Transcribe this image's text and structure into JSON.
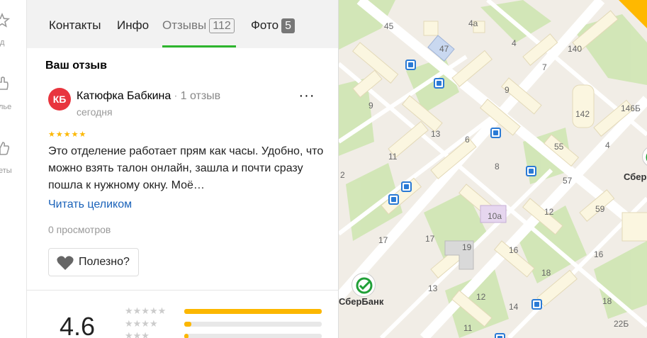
{
  "rail": {
    "items": [
      {
        "label": "д"
      },
      {
        "label": "лье"
      },
      {
        "label": "еты"
      }
    ]
  },
  "tabs": [
    {
      "label": "Контакты"
    },
    {
      "label": "Инфо"
    },
    {
      "label": "Отзывы",
      "count": "112"
    },
    {
      "label": "Фото",
      "count": "5"
    }
  ],
  "section_title": "Ваш отзыв",
  "review": {
    "avatar_initials": "КБ",
    "avatar_color": "#e8353e",
    "author": "Катюфка Бабкина",
    "author_reviews": "1 отзыв",
    "date": "сегодня",
    "more": "···",
    "stars": "★★★★★",
    "rating_stars": 5,
    "text": "Это отделение работает прям как часы. Удобно, что можно взять талон онлайн, зашла и почти сразу пошла к нужному окну. Моё…",
    "read_more": "Читать целиком",
    "views": "0 просмотров",
    "helpful": "Полезно?"
  },
  "summary": {
    "rating": "4.6",
    "distribution": [
      {
        "stars": "★★★★★",
        "share": 1.0
      },
      {
        "stars": "★★★★",
        "share": 0.05
      },
      {
        "stars": "★★★",
        "share": 0.03
      }
    ]
  },
  "map": {
    "poi_label": "СберБанк",
    "poi_label_right": "Сбер",
    "house_numbers": [
      "45",
      "4а",
      "47",
      "4",
      "140",
      "7",
      "9",
      "9",
      "142",
      "146Б",
      "13",
      "6",
      "55",
      "4",
      "11",
      "8",
      "57",
      "2",
      "10а",
      "12",
      "59",
      "17",
      "17",
      "19",
      "16",
      "16",
      "18",
      "13",
      "12",
      "14",
      "18",
      "11",
      "22Б"
    ],
    "colors": {
      "bus": "#2a7ad5",
      "road": "#ffffff",
      "block": "#fbf6e0",
      "green": "#cfe6b2",
      "accent": "#ffb800"
    }
  }
}
